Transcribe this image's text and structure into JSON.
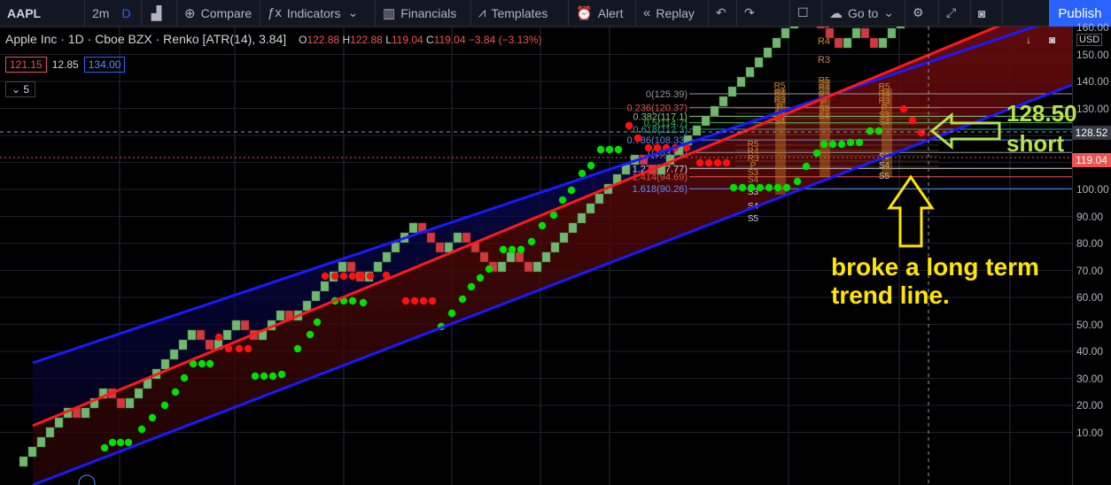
{
  "toolbar": {
    "symbol": "AAPL",
    "interval": "2m",
    "interval_alt": "D",
    "compare": "Compare",
    "indicators": "Indicators",
    "financials": "Financials",
    "templates": "Templates",
    "alert": "Alert",
    "replay": "Replay",
    "goto": "Go to",
    "publish": "Publish"
  },
  "legend": {
    "title": "Apple Inc · 1D · Cboe BZX · Renko [ATR(14), 3.84]",
    "o_label": "O",
    "o": "122.88",
    "h_label": "H",
    "h": "122.88",
    "l_label": "L",
    "l": "119.04",
    "c_label": "C",
    "c": "119.04",
    "change": "−3.84 (−3.13%)"
  },
  "inputs": {
    "bid": "121.15",
    "spread": "12.85",
    "ask": "134.00"
  },
  "collapse_label": "5",
  "axis": {
    "currency": "USD",
    "ticks": [
      "160.00",
      "150.00",
      "140.00",
      "130.00",
      "120.00",
      "110.00",
      "100.00",
      "90.00",
      "80.00",
      "70.00",
      "60.00",
      "50.00",
      "40.00",
      "30.00",
      "20.00",
      "10.00"
    ],
    "crosshair_price": "128.52",
    "last_price": "119.04"
  },
  "fib_levels": [
    "0(125.39)",
    "0.236(120.37)",
    "0.382(117.1)",
    "0.5(114.7)",
    "0.618(112.3)",
    "0.786(108.33)",
    "1(103.68)",
    "1.272(97.77)",
    "1.414(94.69)",
    "1.618(90.26)"
  ],
  "pivot_labels": [
    "R5",
    "R4",
    "R3",
    "P",
    "S3",
    "S4",
    "S5"
  ],
  "annotations": {
    "price": "128.50",
    "action": "short",
    "note": "broke a long term trend line."
  },
  "colors": {
    "up_brick": "#70b870",
    "down_brick": "#d0393d",
    "channel_line": "#1a1aff",
    "trend_line": "#ff1a1a",
    "annotation_green": "#b6e34a",
    "annotation_yellow": "#ffe500",
    "accent": "#2962ff"
  }
}
